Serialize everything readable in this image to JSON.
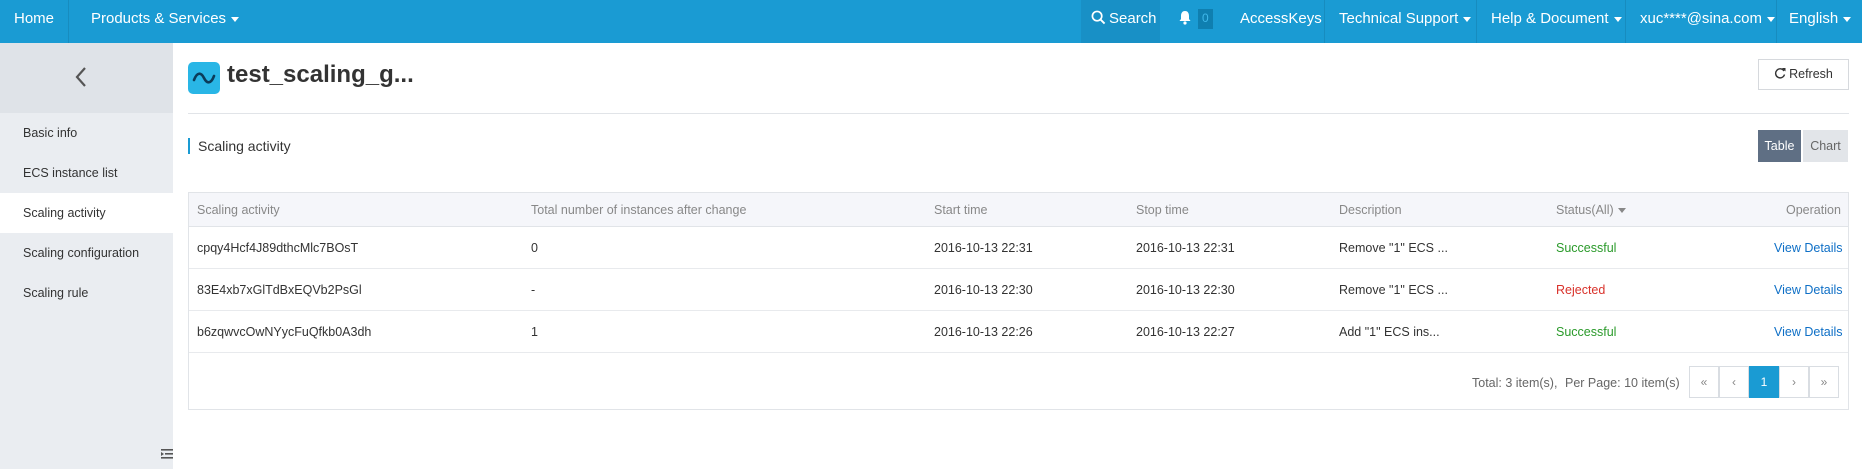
{
  "topnav": {
    "home": "Home",
    "products": "Products & Services",
    "search": "Search",
    "notifications_count": "0",
    "accesskeys": "AccessKeys",
    "technical_support": "Technical Support",
    "help": "Help & Document",
    "account": "xuc****@sina.com",
    "language": "English"
  },
  "sidebar": {
    "items": [
      {
        "label": "Basic info"
      },
      {
        "label": "ECS instance list"
      },
      {
        "label": "Scaling activity"
      },
      {
        "label": "Scaling configuration"
      },
      {
        "label": "Scaling rule"
      }
    ],
    "active_index": 2
  },
  "page": {
    "title": "test_scaling_g...",
    "refresh_label": "Refresh",
    "section_title": "Scaling activity",
    "view_table": "Table",
    "view_chart": "Chart"
  },
  "table": {
    "columns": [
      "Scaling activity",
      "Total number of instances after change",
      "Start time",
      "Stop time",
      "Description",
      "Status(All)",
      "Operation"
    ],
    "rows": [
      {
        "activity": "cpqy4Hcf4J89dthcMlc7BOsT",
        "total": "0",
        "start": "2016-10-13 22:31",
        "stop": "2016-10-13 22:31",
        "description": "Remove \"1\" ECS ...",
        "status": "Successful",
        "operation": "View Details"
      },
      {
        "activity": "83E4xb7xGlTdBxEQVb2PsGl",
        "total": "-",
        "start": "2016-10-13 22:30",
        "stop": "2016-10-13 22:30",
        "description": "Remove \"1\" ECS ...",
        "status": "Rejected",
        "operation": "View Details"
      },
      {
        "activity": "b6zqwvcOwNYycFuQfkb0A3dh",
        "total": "1",
        "start": "2016-10-13 22:26",
        "stop": "2016-10-13 22:27",
        "description": "Add \"1\" ECS ins...",
        "status": "Successful",
        "operation": "View Details"
      }
    ]
  },
  "pagination": {
    "total": "Total: 3 item(s),",
    "per_page": "Per Page: 10 item(s)",
    "first": "«",
    "prev": "‹",
    "current": "1",
    "next": "›",
    "last": "»"
  },
  "colors": {
    "topbar": "#1a9bd3",
    "success": "#2a9a2a",
    "rejected": "#d9322b",
    "link": "#0e6fc6"
  }
}
